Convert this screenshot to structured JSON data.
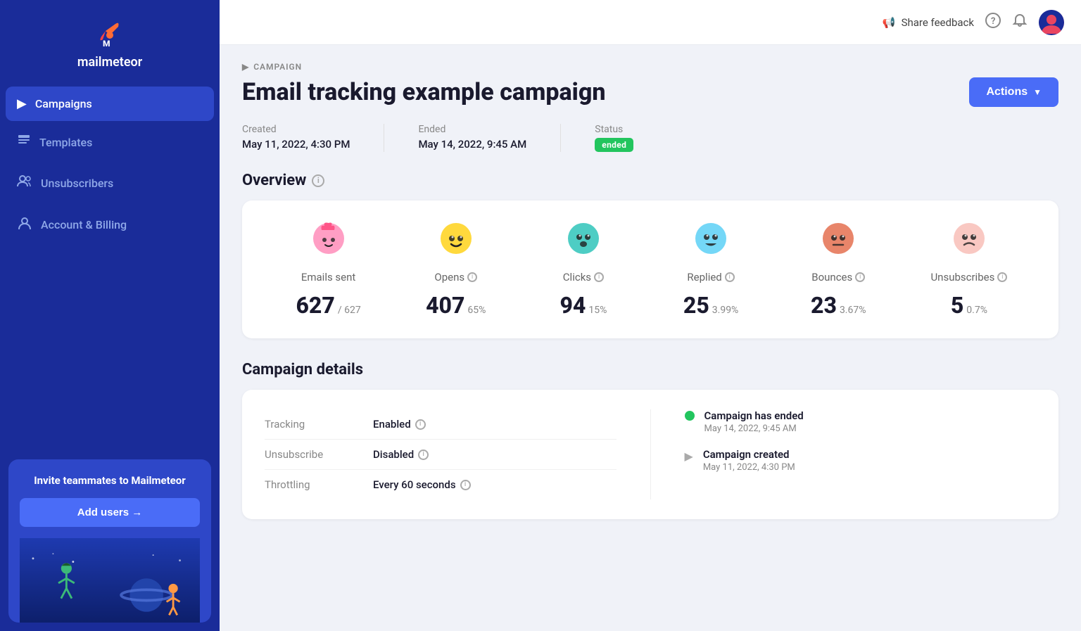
{
  "sidebar": {
    "logo_text": "mailmeteor",
    "nav_items": [
      {
        "id": "campaigns",
        "label": "Campaigns",
        "icon": "▶",
        "active": true
      },
      {
        "id": "templates",
        "label": "Templates",
        "icon": "📄",
        "active": false
      },
      {
        "id": "unsubscribers",
        "label": "Unsubscribers",
        "icon": "👥",
        "active": false
      },
      {
        "id": "account-billing",
        "label": "Account & Billing",
        "icon": "👤",
        "active": false
      }
    ],
    "invite_title": "Invite teammates to Mailmeteor",
    "add_users_label": "Add users →"
  },
  "topbar": {
    "share_feedback_label": "Share feedback",
    "help_icon": "?",
    "bell_icon": "🔔"
  },
  "page": {
    "breadcrumb_icon": "▶",
    "breadcrumb_label": "CAMPAIGN",
    "title": "Email tracking example campaign",
    "actions_label": "Actions",
    "created_label": "Created",
    "created_value": "May 11, 2022, 4:30 PM",
    "ended_label": "Ended",
    "ended_value": "May 14, 2022, 9:45 AM",
    "status_label": "Status",
    "status_value": "ended",
    "overview_title": "Overview",
    "stats": [
      {
        "id": "emails-sent",
        "emoji": "🌸",
        "label": "Emails sent",
        "number": "627",
        "secondary": "/ 627",
        "percent": null
      },
      {
        "id": "opens",
        "emoji": "😊",
        "label": "Opens",
        "number": "407",
        "secondary": null,
        "percent": "65%"
      },
      {
        "id": "clicks",
        "emoji": "😮",
        "label": "Clicks",
        "number": "94",
        "secondary": null,
        "percent": "15%"
      },
      {
        "id": "replied",
        "emoji": "😁",
        "label": "Replied",
        "number": "25",
        "secondary": null,
        "percent": "3.99%"
      },
      {
        "id": "bounces",
        "emoji": "😑",
        "label": "Bounces",
        "number": "23",
        "secondary": null,
        "percent": "3.67%"
      },
      {
        "id": "unsubscribes",
        "emoji": "🙁",
        "label": "Unsubscribes",
        "number": "5",
        "secondary": null,
        "percent": "0.7%"
      }
    ],
    "details_title": "Campaign details",
    "details": [
      {
        "key": "Tracking",
        "value": "Enabled",
        "has_info": true
      },
      {
        "key": "Unsubscribe",
        "value": "Disabled",
        "has_info": true
      },
      {
        "key": "Throttling",
        "value": "Every 60 seconds",
        "has_info": true
      }
    ],
    "timeline": [
      {
        "type": "green",
        "title": "Campaign has ended",
        "date": "May 14, 2022, 9:45 AM"
      },
      {
        "type": "arrow",
        "title": "Campaign created",
        "date": "May 11, 2022, 4:30 PM"
      }
    ]
  }
}
